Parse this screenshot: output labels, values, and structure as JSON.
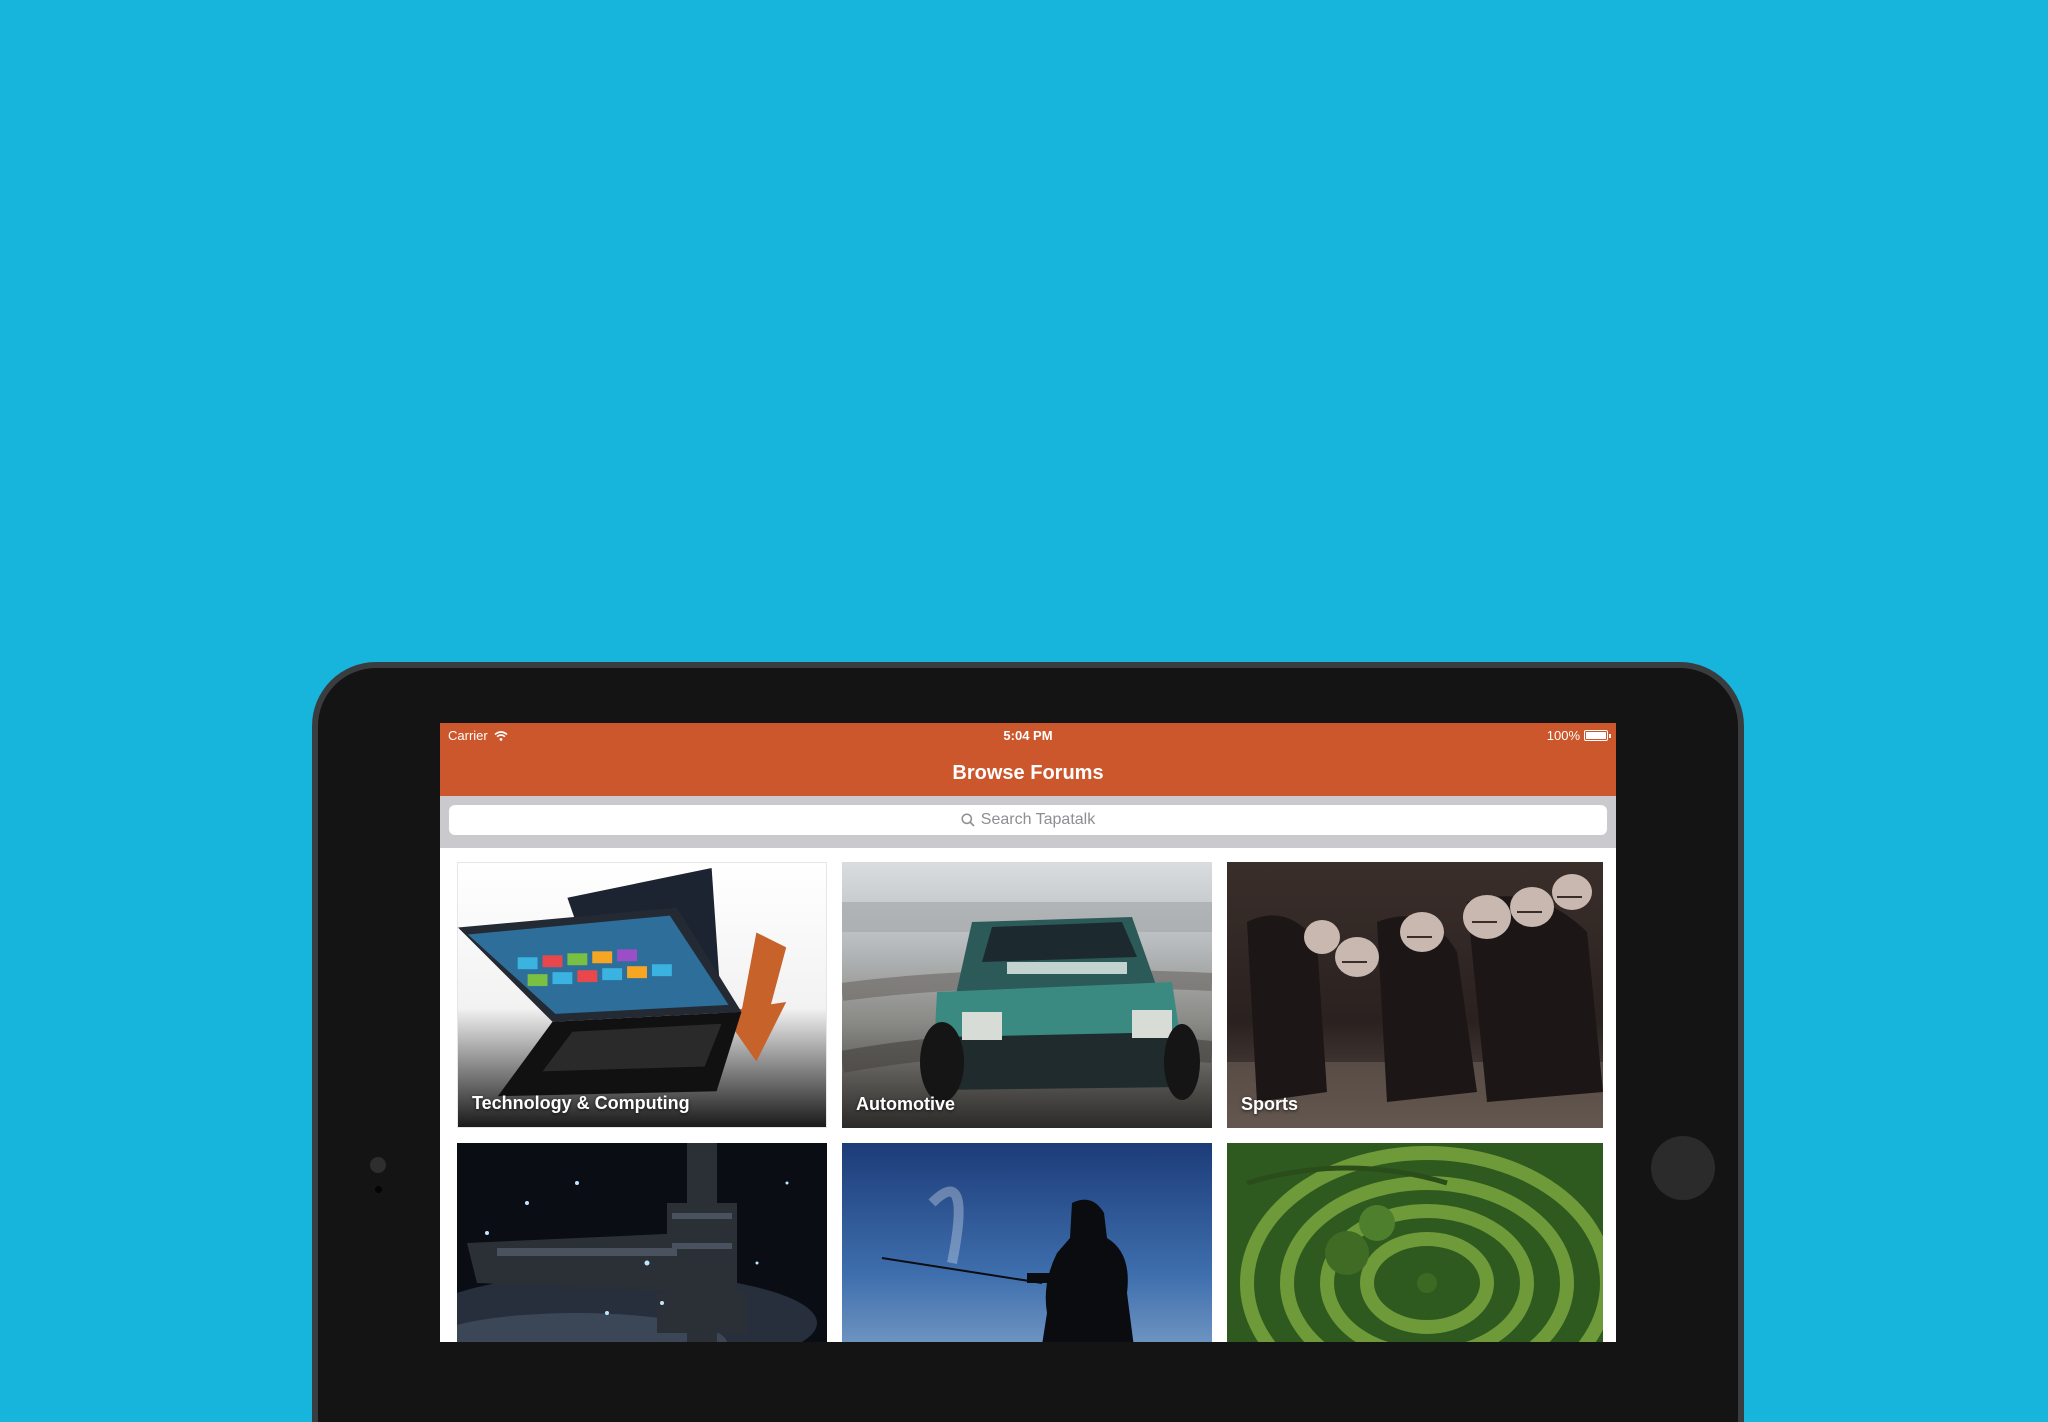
{
  "status_bar": {
    "carrier": "Carrier",
    "time": "5:04 PM",
    "battery": "100%"
  },
  "nav": {
    "title": "Browse Forums"
  },
  "search": {
    "placeholder": "Search Tapatalk"
  },
  "categories": [
    {
      "label": "Technology & Computing",
      "icon": "laptop-photo"
    },
    {
      "label": "Automotive",
      "icon": "car-photo"
    },
    {
      "label": "Sports",
      "icon": "football-photo"
    },
    {
      "label": "",
      "icon": "spaceship-photo"
    },
    {
      "label": "",
      "icon": "fishing-photo"
    },
    {
      "label": "",
      "icon": "maze-photo"
    }
  ],
  "colors": {
    "background": "#17b4db",
    "brand_bar": "#cc572c",
    "device_frame": "#141414"
  }
}
